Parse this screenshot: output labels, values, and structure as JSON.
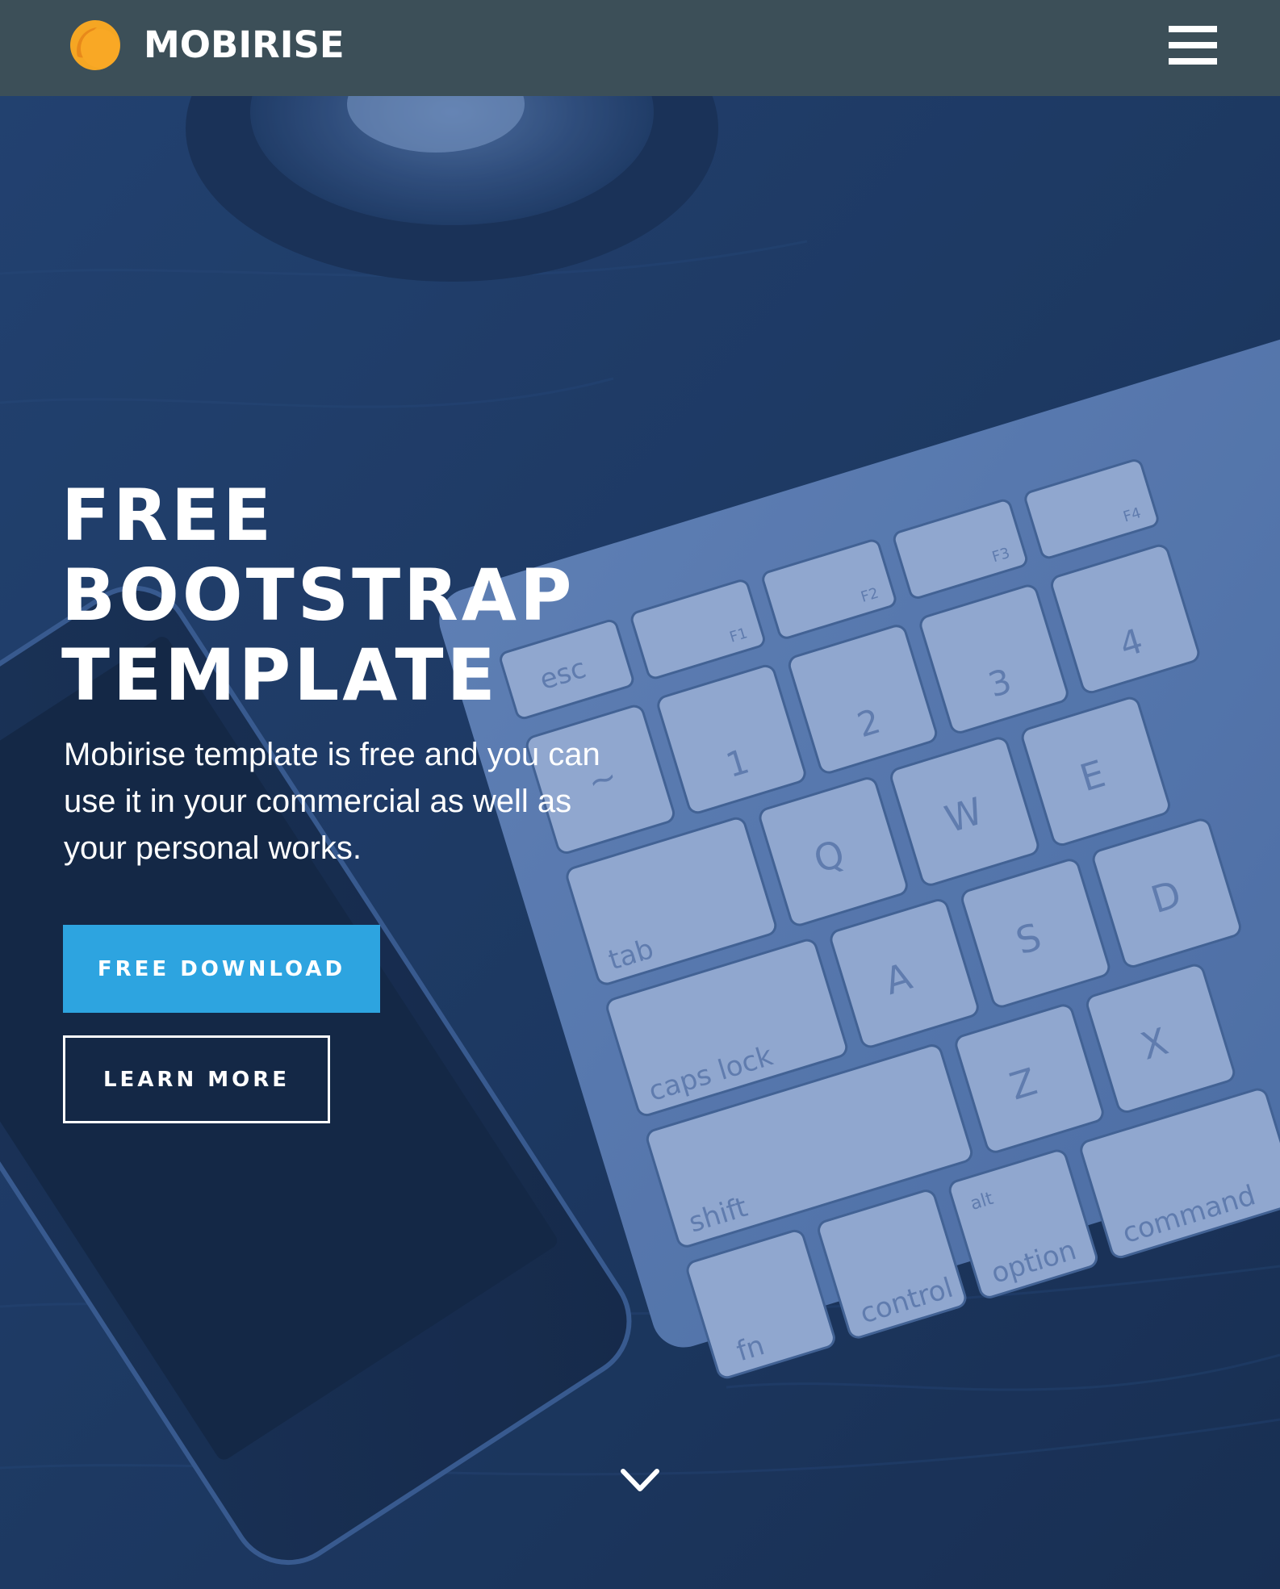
{
  "navbar": {
    "brand_name": "MOBIRISE",
    "logo_icon": "mobirise-logo-icon",
    "menu_icon": "hamburger-menu-icon",
    "background_color": "#3c4f58"
  },
  "hero": {
    "title_lines": [
      "FREE",
      "BOOTSTRAP",
      "TEMPLATE"
    ],
    "text": "Mobirise template is free and you can use it in your commercial as well as your personal works.",
    "primary_button_label": "FREE DOWNLOAD",
    "secondary_button_label": "LEARN MORE",
    "scroll_icon": "chevron-down-icon",
    "primary_color": "#2da4e0",
    "keyboard_keys": [
      "esc",
      "F1",
      "F2",
      "F3",
      "F4",
      "~",
      "1",
      "2",
      "3",
      "4",
      "Q",
      "W",
      "E",
      "tab",
      "A",
      "S",
      "D",
      "caps lock",
      "Z",
      "X",
      "shift",
      "fn",
      "control",
      "alt",
      "option",
      "command"
    ]
  }
}
